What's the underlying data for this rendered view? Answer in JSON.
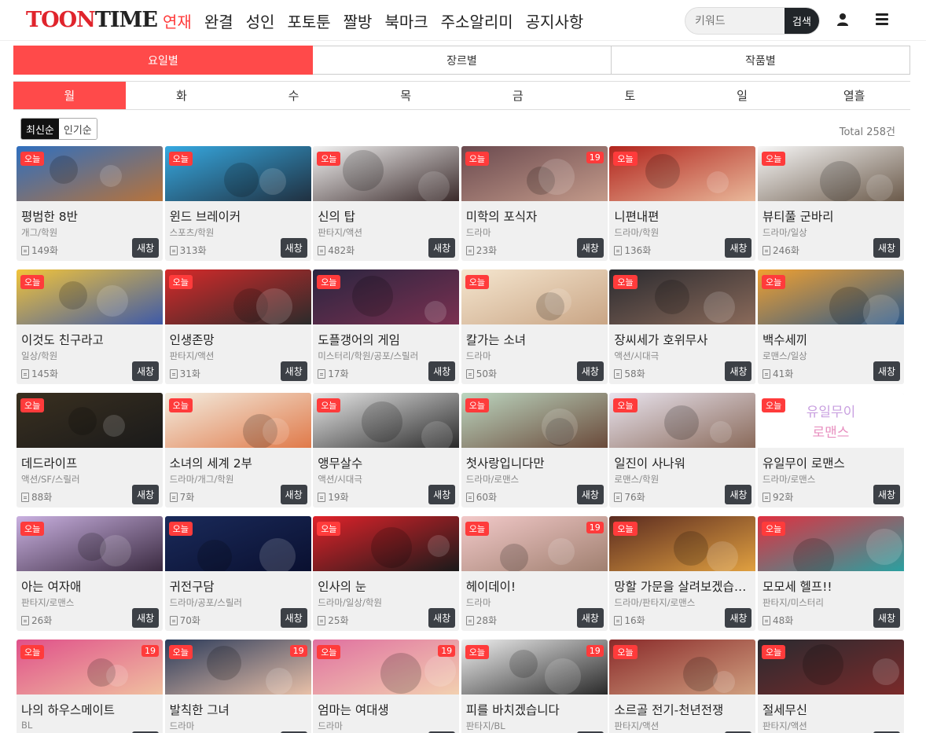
{
  "header": {
    "logo_toon": "TOON",
    "logo_time": "TIME",
    "nav": [
      "연재",
      "완결",
      "성인",
      "포토툰",
      "짤방",
      "북마크",
      "주소알리미",
      "공지사항"
    ],
    "search_placeholder": "키워드",
    "search_label": "검색"
  },
  "category_tabs": [
    "요일별",
    "장르별",
    "작품별"
  ],
  "day_tabs": [
    "월",
    "화",
    "수",
    "목",
    "금",
    "토",
    "일",
    "열흘"
  ],
  "sort": {
    "latest": "최신순",
    "popular": "인기순"
  },
  "total": "Total 258건",
  "labels": {
    "today": "오늘",
    "new_window": "새창",
    "adult": "19"
  },
  "colors": {
    "accent": "#ff4a4a",
    "dark_button": "#3c4046"
  },
  "cards": [
    {
      "title": "평범한 8반",
      "genre": "개그/학원",
      "eps": "149화",
      "adult": false,
      "bg": [
        "#2f6fbf",
        "#b7733b"
      ]
    },
    {
      "title": "윈드 브레이커",
      "genre": "스포츠/학원",
      "eps": "313화",
      "adult": false,
      "bg": [
        "#36a9e1",
        "#203040"
      ]
    },
    {
      "title": "신의 탑",
      "genre": "판타지/액션",
      "eps": "482화",
      "adult": false,
      "bg": [
        "#f2f2f2",
        "#3a2a2a"
      ]
    },
    {
      "title": "미학의 포식자",
      "genre": "드라마",
      "eps": "23화",
      "adult": true,
      "bg": [
        "#6b4a4f",
        "#c39a8a"
      ]
    },
    {
      "title": "니편내편",
      "genre": "드라마/학원",
      "eps": "136화",
      "adult": false,
      "bg": [
        "#b1241d",
        "#e9b89a"
      ]
    },
    {
      "title": "뷰티풀 군바리",
      "genre": "드라마/일상",
      "eps": "246화",
      "adult": false,
      "bg": [
        "#f7f7f7",
        "#6b5a4a"
      ]
    },
    {
      "title": "이것도 친구라고",
      "genre": "일상/학원",
      "eps": "145화",
      "adult": false,
      "bg": [
        "#f2c43a",
        "#3e5aa8"
      ]
    },
    {
      "title": "인생존망",
      "genre": "판타지/액션",
      "eps": "31화",
      "adult": false,
      "bg": [
        "#d72a2a",
        "#2b2b2b"
      ]
    },
    {
      "title": "도플갱어의 게임",
      "genre": "미스터리/학원/공포/스릴러",
      "eps": "17화",
      "adult": false,
      "bg": [
        "#2a2540",
        "#7a3050"
      ]
    },
    {
      "title": "칼가는 소녀",
      "genre": "드라마",
      "eps": "50화",
      "adult": false,
      "bg": [
        "#f5e6cf",
        "#c9a585"
      ]
    },
    {
      "title": "장씨세가 호위무사",
      "genre": "액션/시대극",
      "eps": "58화",
      "adult": false,
      "bg": [
        "#2a2a2f",
        "#8a6a5a"
      ]
    },
    {
      "title": "백수세끼",
      "genre": "로맨스/일상",
      "eps": "41화",
      "adult": false,
      "bg": [
        "#f0a030",
        "#2e5a8a"
      ]
    },
    {
      "title": "데드라이프",
      "genre": "액션/SF/스릴러",
      "eps": "88화",
      "adult": false,
      "bg": [
        "#3a3020",
        "#1a1a1a"
      ]
    },
    {
      "title": "소녀의 세계 2부",
      "genre": "드라마/개그/학원",
      "eps": "7화",
      "adult": false,
      "bg": [
        "#f3ede0",
        "#e07a4a"
      ]
    },
    {
      "title": "앵무살수",
      "genre": "액션/시대극",
      "eps": "19화",
      "adult": false,
      "bg": [
        "#e8e8e8",
        "#2a2a2a"
      ]
    },
    {
      "title": "첫사랑입니다만",
      "genre": "드라마/로맨스",
      "eps": "60화",
      "adult": false,
      "bg": [
        "#bcd6c0",
        "#6a4a3a"
      ]
    },
    {
      "title": "일진이 사나워",
      "genre": "로맨스/학원",
      "eps": "76화",
      "adult": false,
      "bg": [
        "#e9e4ef",
        "#8a6a5a"
      ]
    },
    {
      "title": "유일무이 로맨스",
      "genre": "드라마/로맨스",
      "eps": "92화",
      "adult": false,
      "bg": [
        "#ffffff",
        "#ffffff"
      ],
      "cover_text": [
        "유일무이",
        "로맨스"
      ]
    },
    {
      "title": "아는 여자애",
      "genre": "판타지/로맨스",
      "eps": "26화",
      "adult": false,
      "bg": [
        "#c9b0e0",
        "#3a2a40"
      ]
    },
    {
      "title": "귀전구담",
      "genre": "드라마/공포/스릴러",
      "eps": "70화",
      "adult": false,
      "bg": [
        "#1a2a5a",
        "#0a1030"
      ]
    },
    {
      "title": "인사의 눈",
      "genre": "드라마/일상/학원",
      "eps": "25화",
      "adult": false,
      "bg": [
        "#e0222a",
        "#1a1a1a"
      ]
    },
    {
      "title": "헤이데이!",
      "genre": "드라마",
      "eps": "28화",
      "adult": true,
      "bg": [
        "#f2c9c9",
        "#a08070"
      ]
    },
    {
      "title": "망할 가문을 살려보겠습니다",
      "genre": "드라마/판타지/로맨스",
      "eps": "16화",
      "adult": false,
      "bg": [
        "#5a2a20",
        "#e0a040"
      ]
    },
    {
      "title": "모모세 헬프!!",
      "genre": "판타지/미스터리",
      "eps": "48화",
      "adult": false,
      "bg": [
        "#e03040",
        "#2aa0a0"
      ]
    },
    {
      "title": "나의 하우스메이트",
      "genre": "BL",
      "eps": "",
      "adult": true,
      "bg": [
        "#e0508a",
        "#f0c0a0"
      ]
    },
    {
      "title": "발칙한 그녀",
      "genre": "드라마",
      "eps": "",
      "adult": true,
      "bg": [
        "#2a3a5a",
        "#e8c0a8"
      ]
    },
    {
      "title": "엄마는 여대생",
      "genre": "드라마",
      "eps": "",
      "adult": true,
      "bg": [
        "#e070a0",
        "#f2d0b0"
      ]
    },
    {
      "title": "피를 바치겠습니다",
      "genre": "판타지/BL",
      "eps": "",
      "adult": true,
      "bg": [
        "#f0f0f0",
        "#2a2a2a"
      ]
    },
    {
      "title": "소르골 전기-천년전쟁",
      "genre": "판타지/액션",
      "eps": "",
      "adult": false,
      "bg": [
        "#8a2a2a",
        "#d0a080"
      ]
    },
    {
      "title": "절세무신",
      "genre": "판타지/액션",
      "eps": "",
      "adult": false,
      "bg": [
        "#2a2a30",
        "#7a2a2a"
      ]
    }
  ]
}
